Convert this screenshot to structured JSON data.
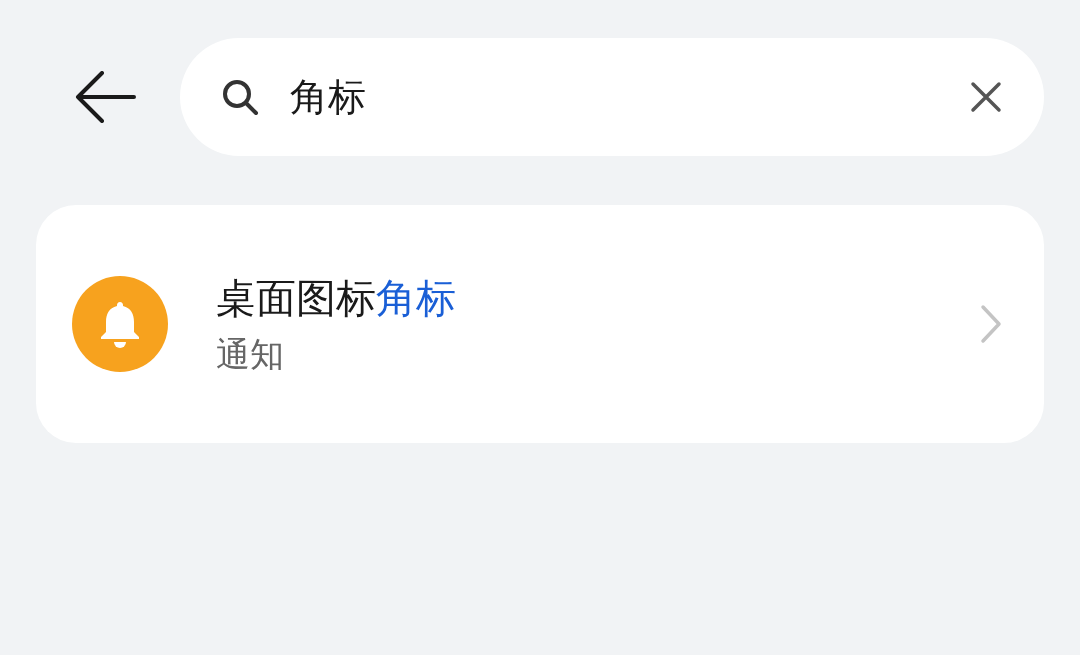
{
  "search": {
    "value": "角标"
  },
  "results": [
    {
      "title_parts": [
        {
          "text": "桌面图标",
          "highlighted": false
        },
        {
          "text": "角标",
          "highlighted": true
        }
      ],
      "subtitle": "通知",
      "color": "#f7a21e"
    }
  ]
}
